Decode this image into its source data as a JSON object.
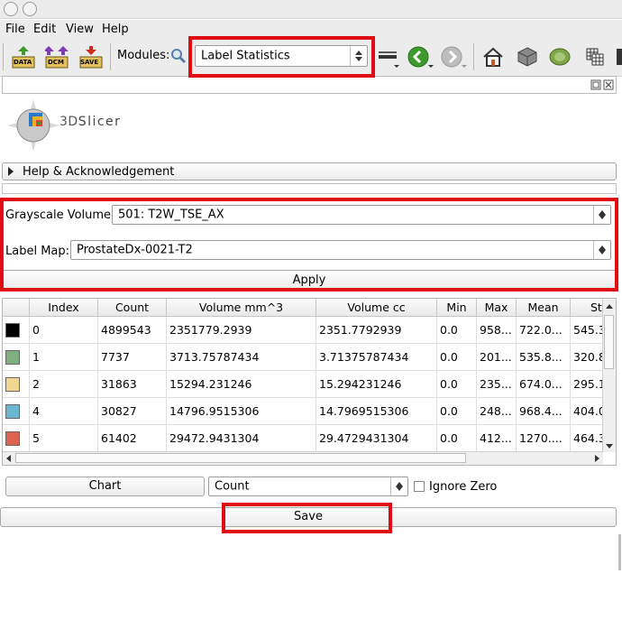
{
  "menu": {
    "file": "File",
    "edit": "Edit",
    "view": "View",
    "help": "Help"
  },
  "toolbar": {
    "data_label": "DATA",
    "dcm_label": "DCM",
    "save_label": "SAVE",
    "modules_label": "Modules:",
    "module_selected": "Label Statistics"
  },
  "logo": {
    "prefix": "3D",
    "name": "Slicer"
  },
  "help_section": {
    "label": "Help & Acknowledgement"
  },
  "form": {
    "grayscale_label": "Grayscale Volume:",
    "grayscale_value": "501: T2W_TSE_AX",
    "labelmap_label": "Label Map:",
    "labelmap_value": "ProstateDx-0021-T2",
    "apply_label": "Apply"
  },
  "table": {
    "headers": [
      "",
      "Index",
      "Count",
      "Volume mm^3",
      "Volume cc",
      "Min",
      "Max",
      "Mean",
      "StdDev"
    ],
    "rows": [
      {
        "color": "#000000",
        "cells": [
          "0",
          "4899543",
          "2351779.2939",
          "2351.7792939",
          "0.0",
          "958...",
          "722.0...",
          "545.3..."
        ]
      },
      {
        "color": "#80ae80",
        "cells": [
          "1",
          "7737",
          "3713.75787434",
          "3.71375787434",
          "0.0",
          "201...",
          "535.8...",
          "320.8..."
        ]
      },
      {
        "color": "#f1d691",
        "cells": [
          "2",
          "31863",
          "15294.231246",
          "15.294231246",
          "0.0",
          "235...",
          "674.0...",
          "295.1..."
        ]
      },
      {
        "color": "#6cb6d0",
        "cells": [
          "4",
          "30827",
          "14796.9515306",
          "14.7969515306",
          "0.0",
          "248...",
          "968.4...",
          "404.0..."
        ]
      },
      {
        "color": "#dd6250",
        "cells": [
          "5",
          "61402",
          "29472.9431304",
          "29.4729431304",
          "0.0",
          "412...",
          "1270....",
          "464.3..."
        ]
      }
    ]
  },
  "bottom": {
    "chart_label": "Chart",
    "chart_select": "Count",
    "ignore_zero_label": "Ignore Zero",
    "ignore_zero_checked": false,
    "save_label": "Save"
  },
  "colors": {
    "highlight": "#e10c13",
    "accent_green": "#3f9a2e"
  }
}
